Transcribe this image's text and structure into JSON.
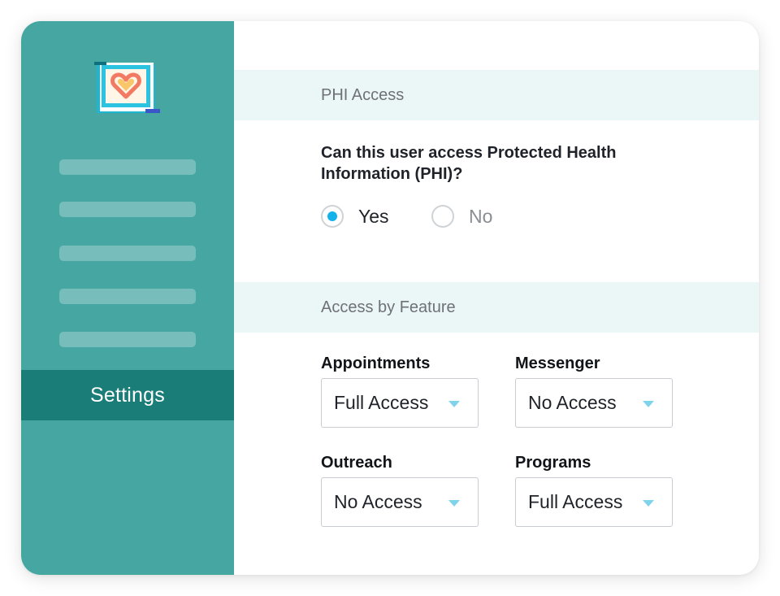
{
  "colors": {
    "sidebar": "#46a6a2",
    "sidebar_active": "#1b7d78",
    "section_header_bg": "#eaf7f6",
    "radio_selected": "#14b2ea",
    "caret": "#7fd3ea"
  },
  "sidebar": {
    "logo_icon": "heart-app-logo-icon",
    "nav_placeholder_count": 5,
    "active_item": {
      "label": "Settings"
    }
  },
  "phi": {
    "header": "PHI Access",
    "question": "Can this user access Protected Health Information (PHI)?",
    "options": [
      {
        "label": "Yes",
        "checked": true
      },
      {
        "label": "No",
        "checked": false
      }
    ]
  },
  "features": {
    "header": "Access by Feature",
    "items": [
      {
        "label": "Appointments",
        "value": "Full Access"
      },
      {
        "label": "Messenger",
        "value": "No Access"
      },
      {
        "label": "Outreach",
        "value": "No Access"
      },
      {
        "label": "Programs",
        "value": "Full Access"
      }
    ]
  }
}
